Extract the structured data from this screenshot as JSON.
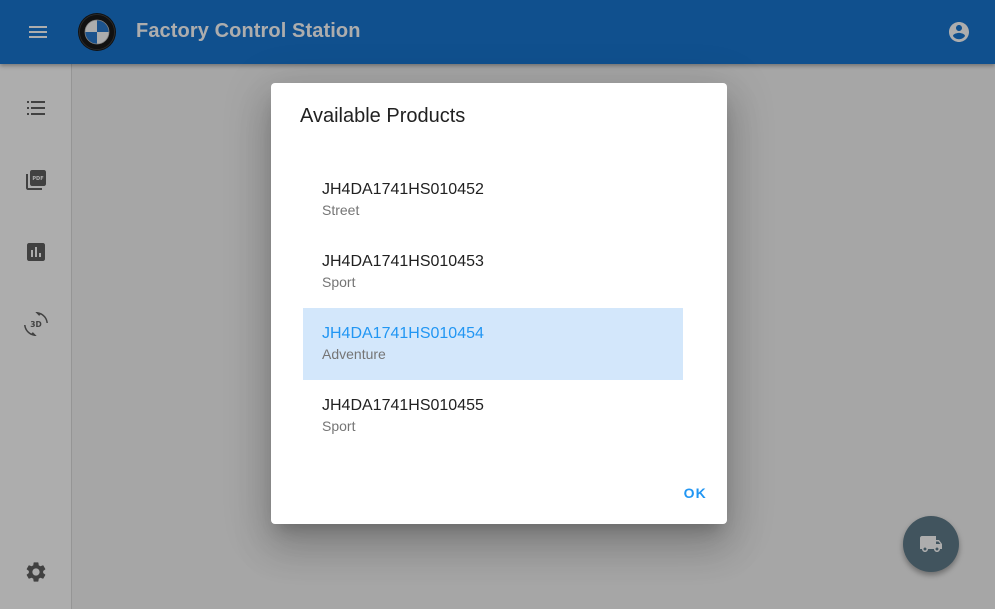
{
  "app": {
    "title": "Factory Control Station"
  },
  "icons": {
    "menu": "menu-icon",
    "logo": "bmw-logo",
    "account": "account-circle-icon",
    "list": "list-icon",
    "pdf": "picture-as-pdf-icon",
    "chart": "bar-chart-icon",
    "3d": "3d-rotation-icon",
    "settings": "gear-icon",
    "truck": "truck-icon"
  },
  "colors": {
    "appbar": "#1976d2",
    "accent": "#2196f3",
    "selected_bg": "#d3e7fb",
    "fab": "#607d8b"
  },
  "dialog": {
    "title": "Available Products",
    "items": [
      {
        "id": "JH4DA1741HS010452",
        "type": "Street",
        "selected": false
      },
      {
        "id": "JH4DA1741HS010453",
        "type": "Sport",
        "selected": false
      },
      {
        "id": "JH4DA1741HS010454",
        "type": "Adventure",
        "selected": true
      },
      {
        "id": "JH4DA1741HS010455",
        "type": "Sport",
        "selected": false
      }
    ],
    "ok_label": "OK"
  }
}
